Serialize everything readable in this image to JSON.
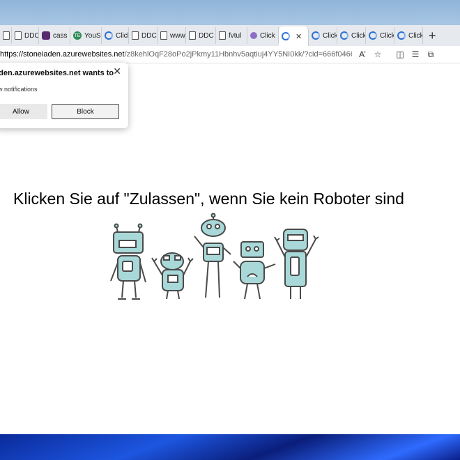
{
  "tabs": [
    {
      "label": "",
      "icon": "doc"
    },
    {
      "label": "DDC",
      "icon": "doc"
    },
    {
      "label": "cass",
      "icon": "purple"
    },
    {
      "label": "YouS",
      "icon": "green"
    },
    {
      "label": "Click",
      "icon": "edge"
    },
    {
      "label": "DDC",
      "icon": "doc"
    },
    {
      "label": "www.",
      "icon": "doc"
    },
    {
      "label": "DDC",
      "icon": "doc"
    },
    {
      "label": "fvtul",
      "icon": "doc"
    },
    {
      "label": "Click",
      "icon": "tor"
    },
    {
      "label": "",
      "icon": "edge",
      "active": true
    },
    {
      "label": "Click",
      "icon": "edge"
    },
    {
      "label": "Click",
      "icon": "edge"
    },
    {
      "label": "Click",
      "icon": "edge"
    },
    {
      "label": "Click",
      "icon": "edge"
    }
  ],
  "address": {
    "host": "https://stoneiaden.azurewebsites.net",
    "path": "/z8kehlOqF28oPo2jPkmy11Hbnhv5aqtiuj4YY5NI0kk/?cid=666f0466d4ffe..."
  },
  "popup": {
    "title": "aden.azurewebsites.net wants to",
    "description": "ow notifications",
    "allow_label": "Allow",
    "block_label": "Block"
  },
  "page": {
    "headline": "Klicken Sie auf \"Zulassen\", wenn Sie kein Roboter sind"
  },
  "colors": {
    "robot_fill": "#a8d8d8",
    "robot_stroke": "#4a4a4a",
    "taskbar": "#1d56e0"
  }
}
